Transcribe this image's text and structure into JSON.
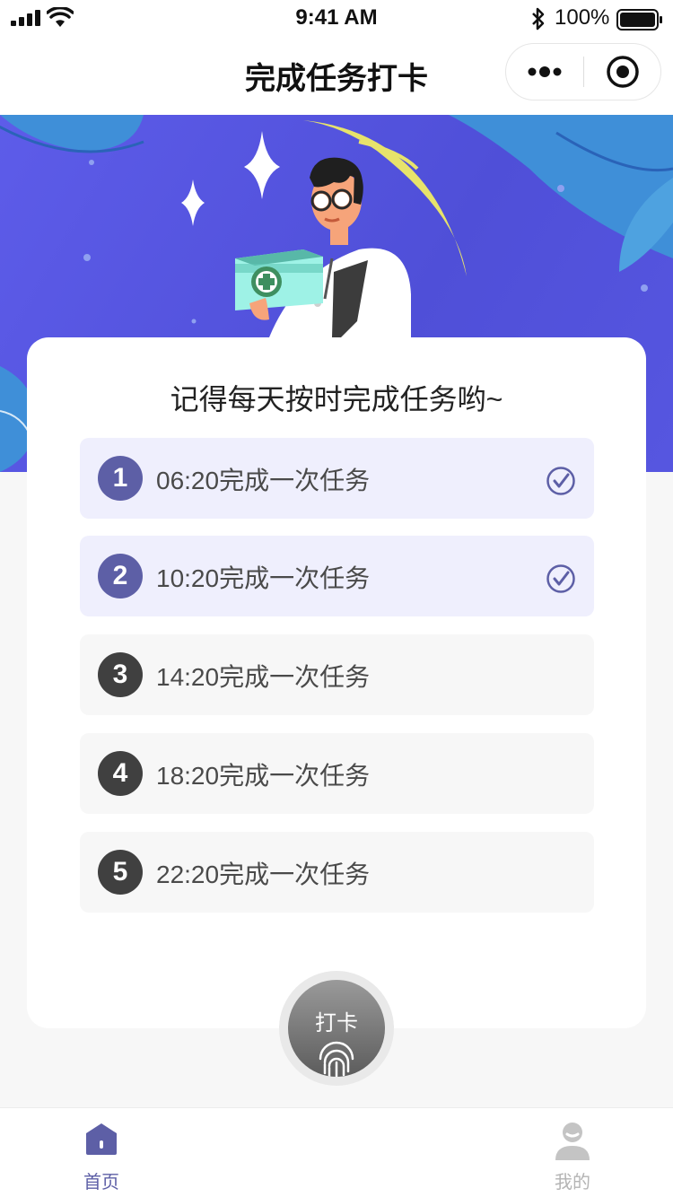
{
  "status_bar": {
    "time": "9:41 AM",
    "battery_percent": "100%",
    "signal_icon": "signal-bars-icon",
    "wifi_icon": "wifi-icon",
    "bluetooth_icon": "bluetooth-icon",
    "battery_icon": "battery-icon"
  },
  "nav": {
    "title": "完成任务打卡",
    "more_icon": "more-dots-icon",
    "close_icon": "target-close-icon"
  },
  "banner": {
    "illustration": "doctor-with-medical-kit-illustration",
    "background_color": "#5d5ce9"
  },
  "card": {
    "title": "记得每天按时完成任务哟~",
    "tasks": [
      {
        "number": "1",
        "text": "06:20完成一次任务",
        "done": true
      },
      {
        "number": "2",
        "text": "10:20完成一次任务",
        "done": true
      },
      {
        "number": "3",
        "text": "14:20完成一次任务",
        "done": false
      },
      {
        "number": "4",
        "text": "18:20完成一次任务",
        "done": false
      },
      {
        "number": "5",
        "text": "22:20完成一次任务",
        "done": false
      }
    ]
  },
  "checkin": {
    "label": "打卡",
    "icon": "fingerprint-icon"
  },
  "tabs": [
    {
      "label": "首页",
      "icon": "home-icon",
      "active": true
    },
    {
      "label": "我的",
      "icon": "user-icon",
      "active": false
    }
  ],
  "colors": {
    "accent": "#5d5fa6",
    "done_row_bg": "#efeffd",
    "pending_row_bg": "#f7f7f7",
    "pending_badge": "#404040",
    "banner_blue": "#5d5ce9"
  }
}
